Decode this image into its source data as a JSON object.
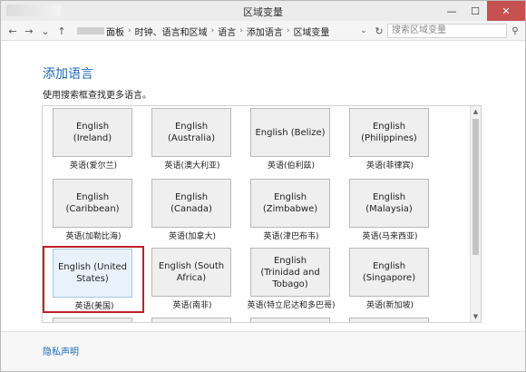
{
  "window": {
    "title": "区域变量",
    "controls": {
      "minimize": "—",
      "maximize": "☐",
      "close": "✕"
    }
  },
  "address": {
    "crumbs": [
      "面板",
      "时钟、语言和区域",
      "语言",
      "添加语言",
      "区域变量"
    ],
    "search_placeholder": "搜索区域变量"
  },
  "content": {
    "heading": "添加语言",
    "subtext": "使用搜索框查找更多语言。"
  },
  "tiles": [
    {
      "label": "English (Ireland)",
      "caption": "英语(爱尔兰)",
      "selected": false
    },
    {
      "label": "English (Australia)",
      "caption": "英语(澳大利亚)",
      "selected": false
    },
    {
      "label": "English (Belize)",
      "caption": "英语(伯利兹)",
      "selected": false
    },
    {
      "label": "English (Philippines)",
      "caption": "英语(菲律宾)",
      "selected": false
    },
    {
      "label": "English (Caribbean)",
      "caption": "英语(加勒比海)",
      "selected": false
    },
    {
      "label": "English (Canada)",
      "caption": "英语(加拿大)",
      "selected": false
    },
    {
      "label": "English (Zimbabwe)",
      "caption": "英语(津巴布韦)",
      "selected": false
    },
    {
      "label": "English (Malaysia)",
      "caption": "英语(马来西亚)",
      "selected": false
    },
    {
      "label": "English (United States)",
      "caption": "英语(美国)",
      "selected": true
    },
    {
      "label": "English (South Africa)",
      "caption": "英语(南非)",
      "selected": false
    },
    {
      "label": "English (Trinidad and Tobago)",
      "caption": "英语(特立尼达和多巴哥)",
      "selected": false
    },
    {
      "label": "English (Singapore)",
      "caption": "英语(新加坡)",
      "selected": false
    }
  ],
  "footer": {
    "privacy": "隐私声明"
  },
  "colors": {
    "accent": "#1e6bb8",
    "selection": "#c0202a",
    "close": "#c75050"
  }
}
